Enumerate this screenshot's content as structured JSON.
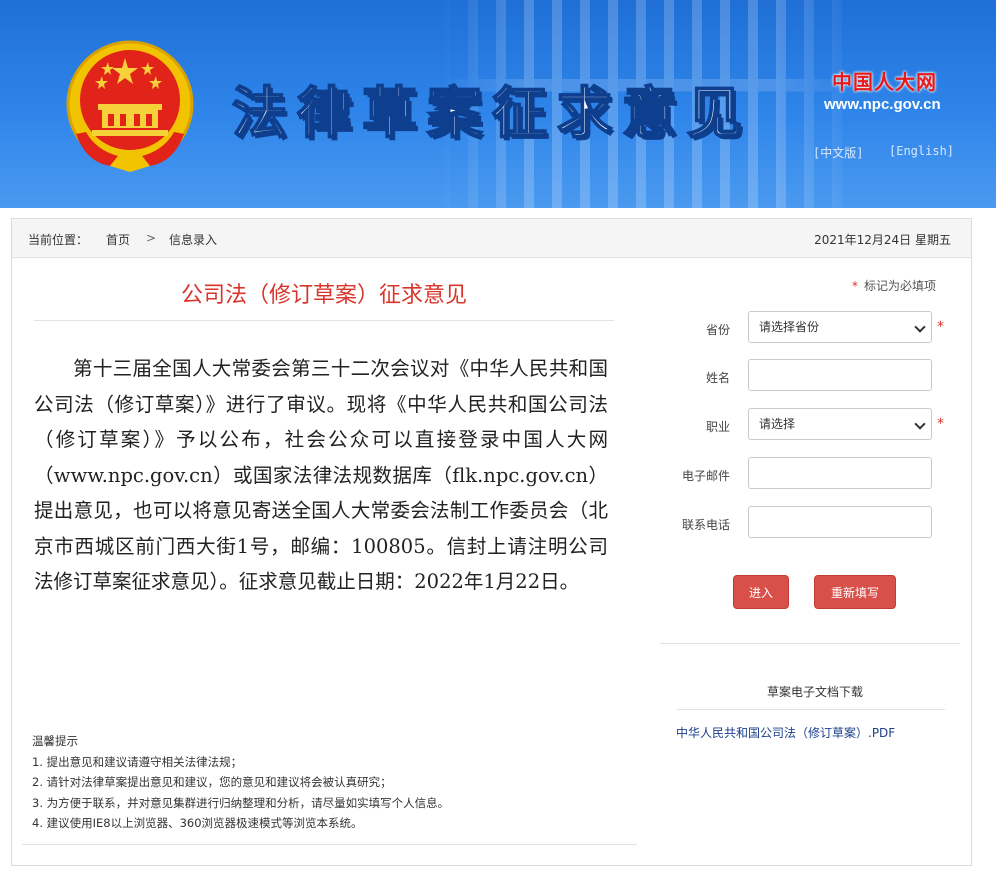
{
  "header": {
    "title": "法律草案征求意见",
    "npc_logo": "中国人大网",
    "npc_url": "www.npc.gov.cn",
    "lang_zh": "[中文版]",
    "lang_en": "[English]"
  },
  "breadcrumb": {
    "label": "当前位置：",
    "home": "首页",
    "separator": ">",
    "current": "信息录入",
    "date": "2021年12月24日  星期五"
  },
  "article": {
    "title": "公司法（修订草案）征求意见",
    "body": "第十三届全国人大常委会第三十二次会议对《中华人民共和国公司法（修订草案）》进行了审议。现将《中华人民共和国公司法（修订草案）》予以公布，社会公众可以直接登录中国人大网（www.npc.gov.cn）或国家法律法规数据库（flk.npc.gov.cn）提出意见，也可以将意见寄送全国人大常委会法制工作委员会（北京市西城区前门西大街1号，邮编：100805。信封上请注明公司法修订草案征求意见）。征求意见截止日期：2022年1月22日。"
  },
  "tips": {
    "heading": "温馨提示",
    "items": [
      "1.  提出意见和建议请遵守相关法律法规；",
      "2.  请针对法律草案提出意见和建议，您的意见和建议将会被认真研究；",
      "3.  为方便于联系，并对意见集群进行归纳整理和分析，请尽量如实填写个人信息。",
      "4.  建议使用IE8以上浏览器、360浏览器极速模式等浏览本系统。"
    ]
  },
  "form": {
    "required_star": "*",
    "required_note": "标记为必填项",
    "province_label": "省份",
    "province_value": "请选择省份",
    "name_label": "姓名",
    "name_value": "",
    "job_label": "职业",
    "job_value": "请选择",
    "email_label": "电子邮件",
    "email_value": "",
    "phone_label": "联系电话",
    "phone_value": "",
    "submit_label": "进入",
    "reset_label": "重新填写"
  },
  "download": {
    "heading": "草案电子文档下载",
    "file": "中华人民共和国公司法（修订草案）.PDF"
  },
  "colors": {
    "header_blue": "#2f85ea",
    "accent_red": "#d9352b",
    "button_red": "#d9504a",
    "link_blue": "#1c3f8c"
  }
}
